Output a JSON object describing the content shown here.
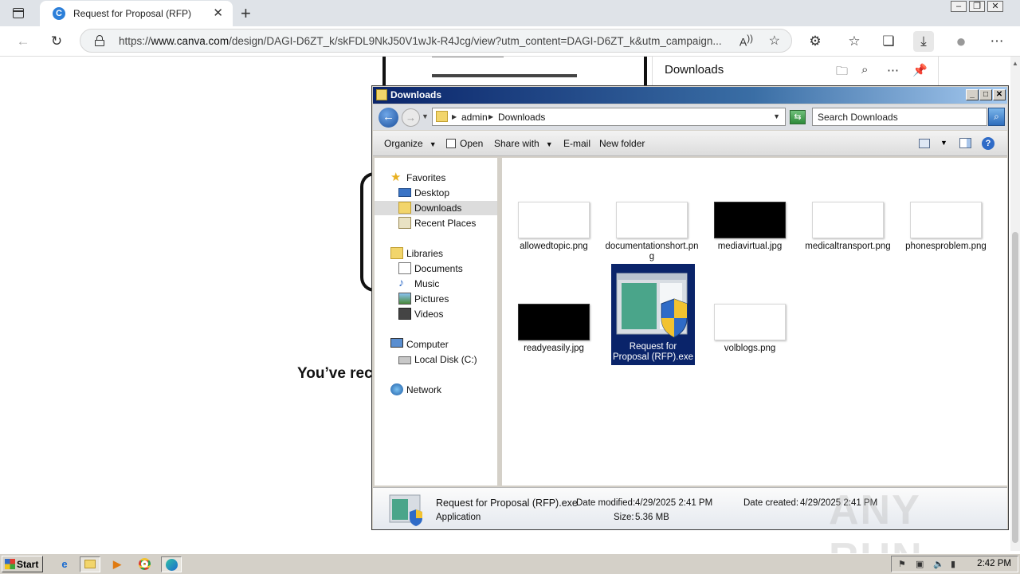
{
  "browser": {
    "tab_title": "Request for Proposal (RFP)",
    "tab_favicon_letter": "C",
    "url_prefix": "https://",
    "url_host": "www.canva.com",
    "url_rest": "/design/DAGI-D6ZT_k/skFDL9NkJ50V1wJk-R4Jcg/view?utm_content=DAGI-D6ZT_k&utm_campaign..."
  },
  "page": {
    "received_text": "You’ve rec"
  },
  "downloads_panel": {
    "title": "Downloads"
  },
  "explorer": {
    "title": "Downloads",
    "breadcrumb": [
      "admin",
      "Downloads"
    ],
    "search_placeholder": "Search Downloads",
    "commands": {
      "organize": "Organize",
      "open": "Open",
      "share_with": "Share with",
      "email": "E-mail",
      "new_folder": "New folder"
    },
    "nav": {
      "favorites": "Favorites",
      "desktop": "Desktop",
      "downloads": "Downloads",
      "recent_places": "Recent Places",
      "libraries": "Libraries",
      "documents": "Documents",
      "music": "Music",
      "pictures": "Pictures",
      "videos": "Videos",
      "computer": "Computer",
      "local_disk": "Local Disk (C:)",
      "network": "Network"
    },
    "files": [
      {
        "name": "allowedtopic.png",
        "thumb": "light"
      },
      {
        "name": "documentationshort.png",
        "thumb": "light"
      },
      {
        "name": "mediavirtual.jpg",
        "thumb": "dark"
      },
      {
        "name": "medicaltransport.png",
        "thumb": "light"
      },
      {
        "name": "phonesproblem.png",
        "thumb": "light"
      },
      {
        "name": "readyeasily.jpg",
        "thumb": "dark"
      },
      {
        "name": "Request for Proposal (RFP).exe",
        "thumb": "exe"
      },
      {
        "name": "volblogs.png",
        "thumb": "light"
      }
    ],
    "details": {
      "name": "Request for Proposal (RFP).exe",
      "type": "Application",
      "date_modified_label": "Date modified:",
      "date_modified": "4/29/2025 2:41 PM",
      "size_label": "Size:",
      "size": "5.36 MB",
      "date_created_label": "Date created:",
      "date_created": "4/29/2025 2:41 PM"
    }
  },
  "taskbar": {
    "start_label": "Start",
    "clock": "2:42 PM"
  },
  "watermark": "ANY RUN"
}
